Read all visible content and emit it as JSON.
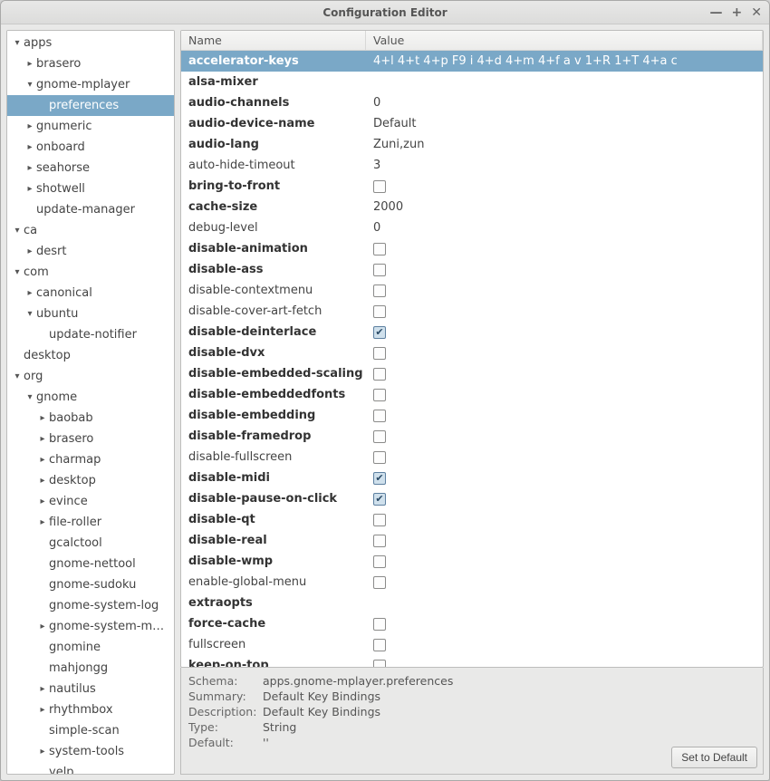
{
  "window": {
    "title": "Configuration Editor"
  },
  "columns": {
    "name": "Name",
    "value": "Value"
  },
  "tree": [
    {
      "depth": 0,
      "exp": "▾",
      "label": "apps"
    },
    {
      "depth": 1,
      "exp": "▸",
      "label": "brasero"
    },
    {
      "depth": 1,
      "exp": "▾",
      "label": "gnome-mplayer"
    },
    {
      "depth": 2,
      "exp": "",
      "label": "preferences",
      "selected": true
    },
    {
      "depth": 1,
      "exp": "▸",
      "label": "gnumeric"
    },
    {
      "depth": 1,
      "exp": "▸",
      "label": "onboard"
    },
    {
      "depth": 1,
      "exp": "▸",
      "label": "seahorse"
    },
    {
      "depth": 1,
      "exp": "▸",
      "label": "shotwell"
    },
    {
      "depth": 1,
      "exp": "",
      "label": "update-manager"
    },
    {
      "depth": 0,
      "exp": "▾",
      "label": "ca"
    },
    {
      "depth": 1,
      "exp": "▸",
      "label": "desrt"
    },
    {
      "depth": 0,
      "exp": "▾",
      "label": "com"
    },
    {
      "depth": 1,
      "exp": "▸",
      "label": "canonical"
    },
    {
      "depth": 1,
      "exp": "▾",
      "label": "ubuntu"
    },
    {
      "depth": 2,
      "exp": "",
      "label": "update-notifier"
    },
    {
      "depth": 0,
      "exp": "",
      "label": "desktop"
    },
    {
      "depth": 0,
      "exp": "▾",
      "label": "org"
    },
    {
      "depth": 1,
      "exp": "▾",
      "label": "gnome"
    },
    {
      "depth": 2,
      "exp": "▸",
      "label": "baobab"
    },
    {
      "depth": 2,
      "exp": "▸",
      "label": "brasero"
    },
    {
      "depth": 2,
      "exp": "▸",
      "label": "charmap"
    },
    {
      "depth": 2,
      "exp": "▸",
      "label": "desktop"
    },
    {
      "depth": 2,
      "exp": "▸",
      "label": "evince"
    },
    {
      "depth": 2,
      "exp": "▸",
      "label": "file-roller"
    },
    {
      "depth": 2,
      "exp": "",
      "label": "gcalctool"
    },
    {
      "depth": 2,
      "exp": "",
      "label": "gnome-nettool"
    },
    {
      "depth": 2,
      "exp": "",
      "label": "gnome-sudoku"
    },
    {
      "depth": 2,
      "exp": "",
      "label": "gnome-system-log"
    },
    {
      "depth": 2,
      "exp": "▸",
      "label": "gnome-system-monitor"
    },
    {
      "depth": 2,
      "exp": "",
      "label": "gnomine"
    },
    {
      "depth": 2,
      "exp": "",
      "label": "mahjongg"
    },
    {
      "depth": 2,
      "exp": "▸",
      "label": "nautilus"
    },
    {
      "depth": 2,
      "exp": "▸",
      "label": "rhythmbox"
    },
    {
      "depth": 2,
      "exp": "",
      "label": "simple-scan"
    },
    {
      "depth": 2,
      "exp": "▸",
      "label": "system-tools"
    },
    {
      "depth": 2,
      "exp": "",
      "label": "yelp"
    }
  ],
  "keys": [
    {
      "name": "accelerator-keys",
      "bold": true,
      "selected": true,
      "type": "text",
      "value": "4+l 4+t 4+p F9 i 4+d 4+m 4+f a v 1+R 1+T 4+a c"
    },
    {
      "name": "alsa-mixer",
      "bold": true,
      "type": "text",
      "value": ""
    },
    {
      "name": "audio-channels",
      "bold": true,
      "type": "text",
      "value": "0"
    },
    {
      "name": "audio-device-name",
      "bold": true,
      "type": "text",
      "value": "Default"
    },
    {
      "name": "audio-lang",
      "bold": true,
      "type": "text",
      "value": "Zuni,zun"
    },
    {
      "name": "auto-hide-timeout",
      "bold": false,
      "type": "text",
      "value": "3"
    },
    {
      "name": "bring-to-front",
      "bold": true,
      "type": "check",
      "checked": false
    },
    {
      "name": "cache-size",
      "bold": true,
      "type": "text",
      "value": "2000"
    },
    {
      "name": "debug-level",
      "bold": false,
      "type": "text",
      "value": "0"
    },
    {
      "name": "disable-animation",
      "bold": true,
      "type": "check",
      "checked": false
    },
    {
      "name": "disable-ass",
      "bold": true,
      "type": "check",
      "checked": false
    },
    {
      "name": "disable-contextmenu",
      "bold": false,
      "type": "check",
      "checked": false
    },
    {
      "name": "disable-cover-art-fetch",
      "bold": false,
      "type": "check",
      "checked": false
    },
    {
      "name": "disable-deinterlace",
      "bold": true,
      "type": "check",
      "checked": true
    },
    {
      "name": "disable-dvx",
      "bold": true,
      "type": "check",
      "checked": false
    },
    {
      "name": "disable-embedded-scaling",
      "bold": true,
      "type": "check",
      "checked": false
    },
    {
      "name": "disable-embeddedfonts",
      "bold": true,
      "type": "check",
      "checked": false
    },
    {
      "name": "disable-embedding",
      "bold": true,
      "type": "check",
      "checked": false
    },
    {
      "name": "disable-framedrop",
      "bold": true,
      "type": "check",
      "checked": false
    },
    {
      "name": "disable-fullscreen",
      "bold": false,
      "type": "check",
      "checked": false
    },
    {
      "name": "disable-midi",
      "bold": true,
      "type": "check",
      "checked": true
    },
    {
      "name": "disable-pause-on-click",
      "bold": true,
      "type": "check",
      "checked": true
    },
    {
      "name": "disable-qt",
      "bold": true,
      "type": "check",
      "checked": false
    },
    {
      "name": "disable-real",
      "bold": true,
      "type": "check",
      "checked": false
    },
    {
      "name": "disable-wmp",
      "bold": true,
      "type": "check",
      "checked": false
    },
    {
      "name": "enable-global-menu",
      "bold": false,
      "type": "check",
      "checked": false
    },
    {
      "name": "extraopts",
      "bold": true,
      "type": "text",
      "value": ""
    },
    {
      "name": "force-cache",
      "bold": true,
      "type": "check",
      "checked": false
    },
    {
      "name": "fullscreen",
      "bold": false,
      "type": "check",
      "checked": false
    },
    {
      "name": "keep-on-top",
      "bold": true,
      "type": "check",
      "checked": false
    }
  ],
  "details": {
    "labels": {
      "schema": "Schema:",
      "summary": "Summary:",
      "description": "Description:",
      "type": "Type:",
      "default": "Default:"
    },
    "schema": "apps.gnome-mplayer.preferences",
    "summary": "Default Key Bindings",
    "description": "Default Key Bindings",
    "type": "String",
    "default": "''",
    "set_default": "Set to Default"
  }
}
